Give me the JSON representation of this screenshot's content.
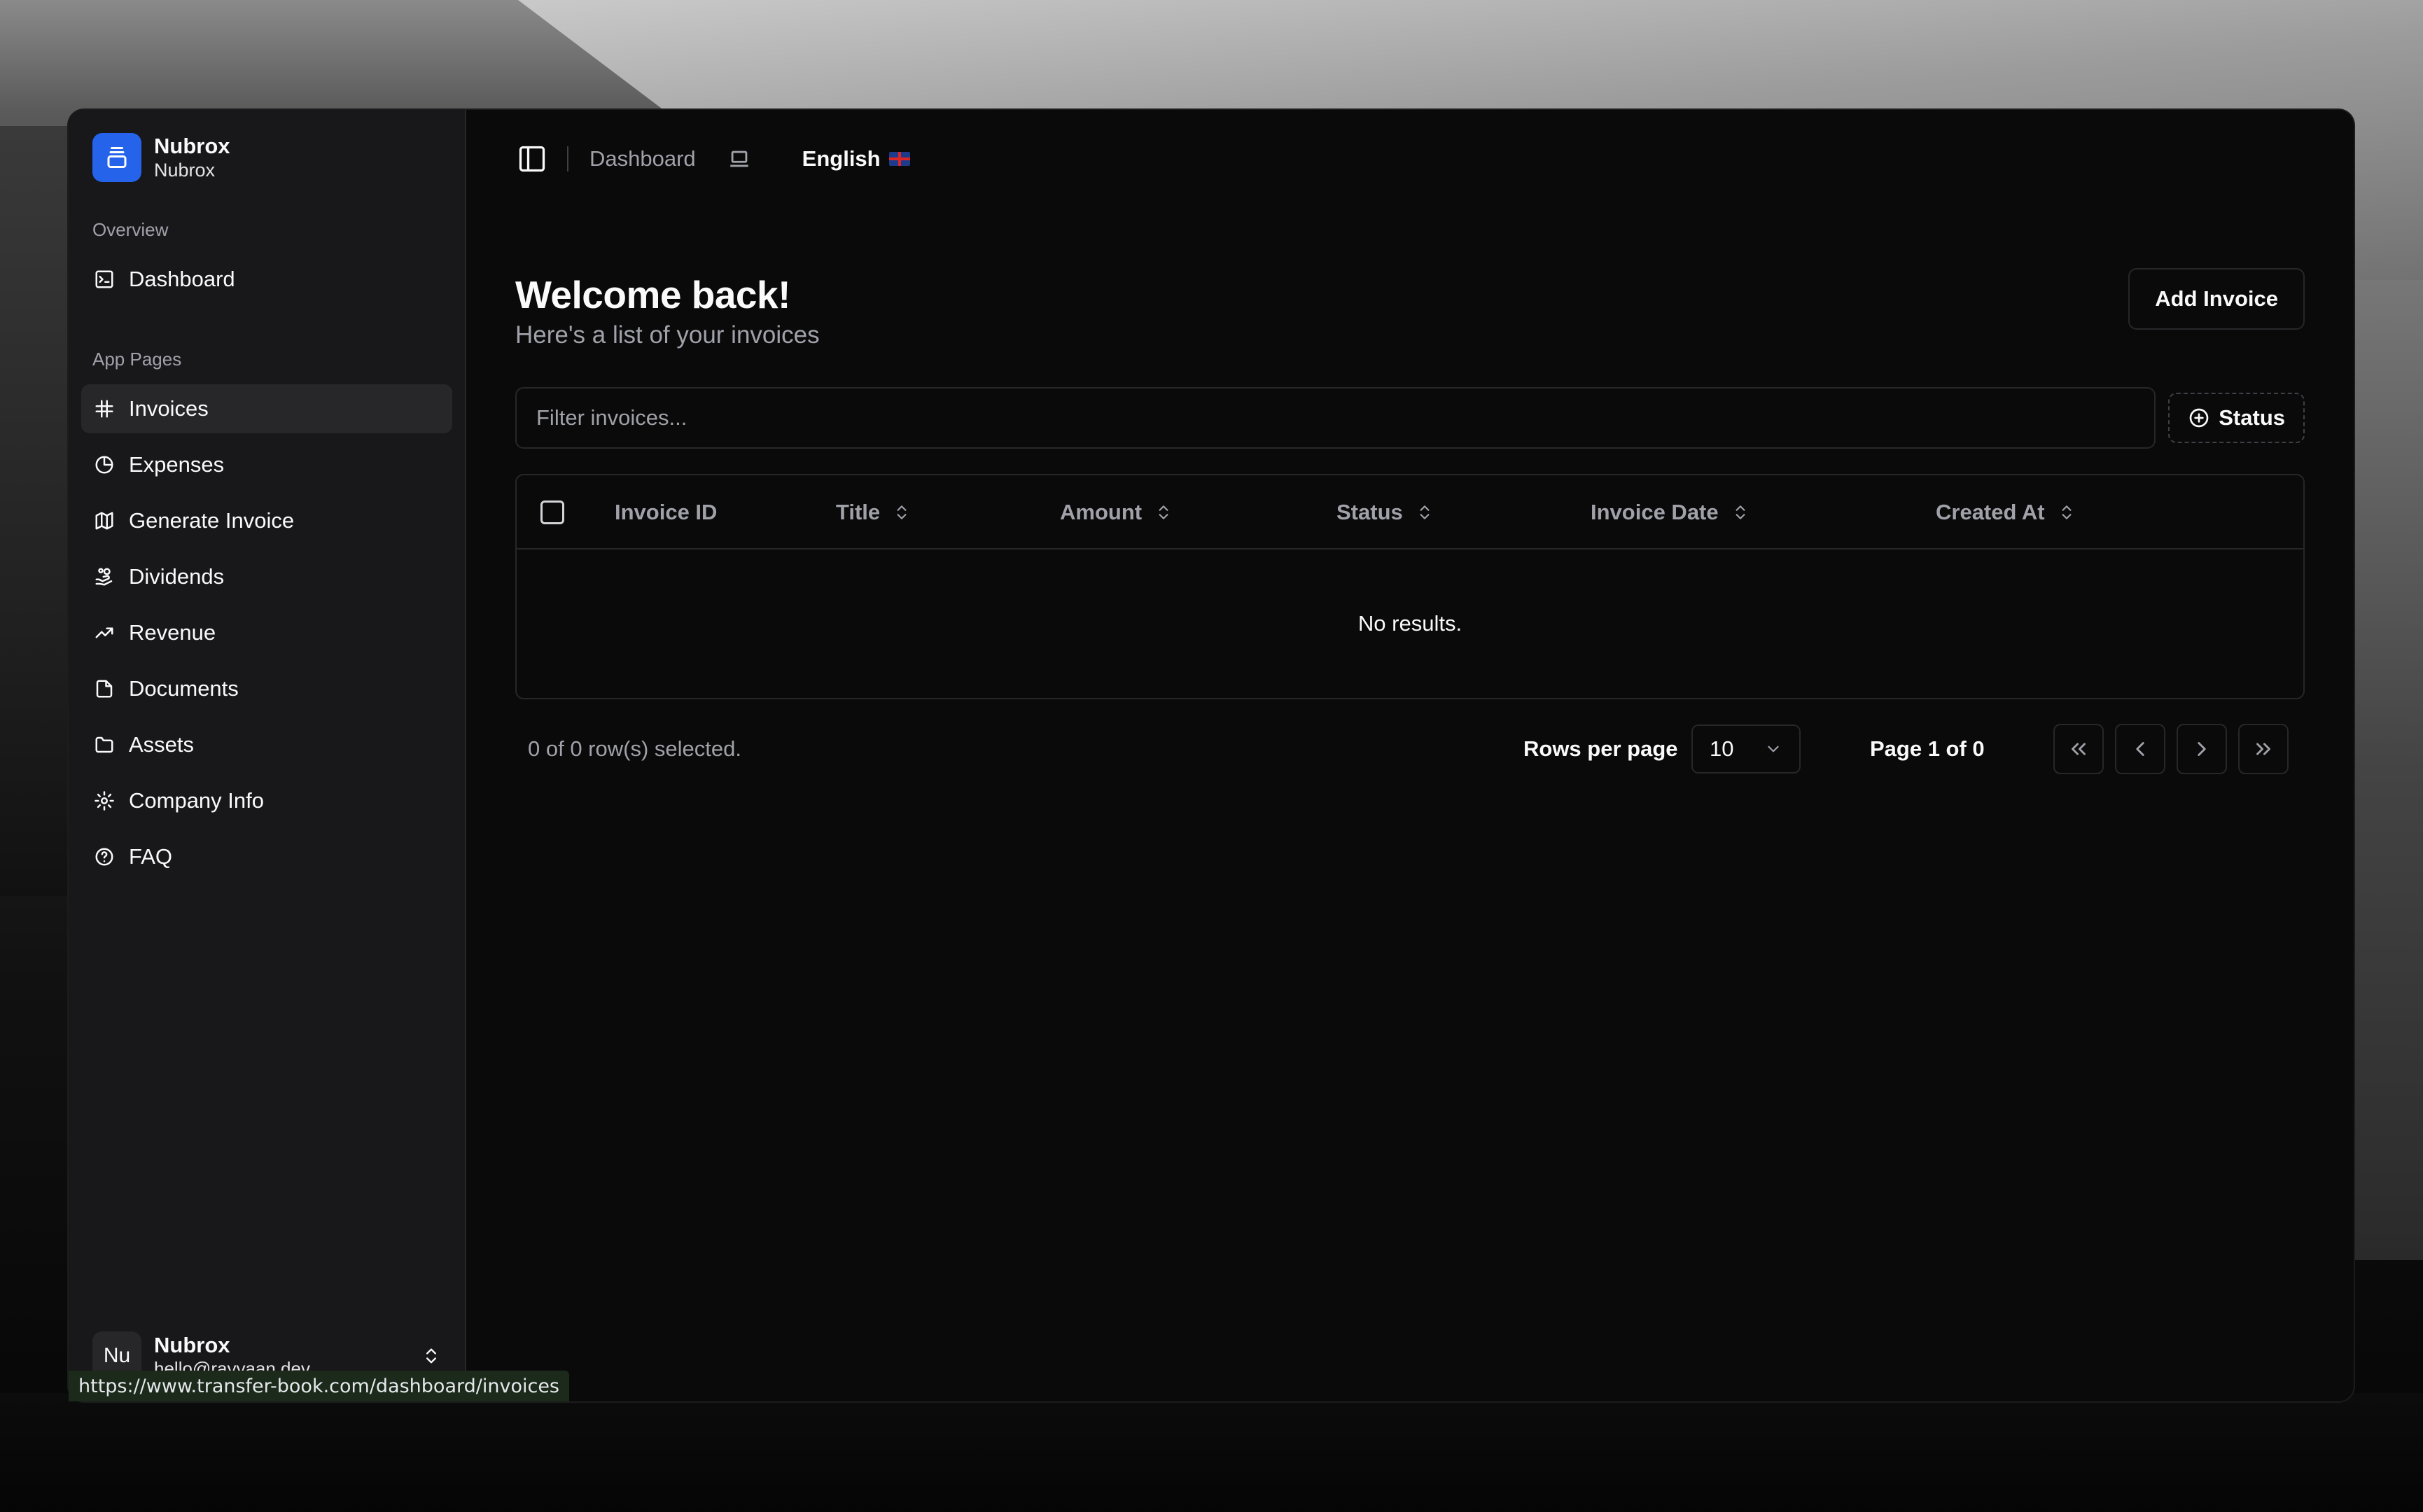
{
  "brand": {
    "name": "Nubrox",
    "subtitle": "Nubrox",
    "accent": "#2563eb"
  },
  "sidebar": {
    "overview_label": "Overview",
    "overview_items": [
      {
        "label": "Dashboard",
        "icon": "dashboard-icon"
      }
    ],
    "app_pages_label": "App Pages",
    "items": [
      {
        "label": "Invoices",
        "icon": "hash-icon",
        "active": true
      },
      {
        "label": "Expenses",
        "icon": "pie-chart-icon"
      },
      {
        "label": "Generate Invoice",
        "icon": "map-icon"
      },
      {
        "label": "Dividends",
        "icon": "hand-coins-icon"
      },
      {
        "label": "Revenue",
        "icon": "trending-up-icon"
      },
      {
        "label": "Documents",
        "icon": "file-icon"
      },
      {
        "label": "Assets",
        "icon": "folder-icon"
      },
      {
        "label": "Company Info",
        "icon": "gear-icon"
      },
      {
        "label": "FAQ",
        "icon": "help-circle-icon"
      }
    ],
    "user": {
      "initials": "Nu",
      "name": "Nubrox",
      "email": "hello@rayyaan.dev"
    }
  },
  "topbar": {
    "breadcrumb": "Dashboard",
    "language": "English"
  },
  "page": {
    "title": "Welcome back!",
    "subtitle": "Here's a list of your invoices",
    "add_button": "Add Invoice"
  },
  "filter": {
    "placeholder": "Filter invoices...",
    "status_button": "Status"
  },
  "table": {
    "columns": [
      "Invoice ID",
      "Title",
      "Amount",
      "Status",
      "Invoice Date",
      "Created At"
    ],
    "empty_text": "No results."
  },
  "pagination": {
    "selected_text": "0 of 0 row(s) selected.",
    "rows_per_page_label": "Rows per page",
    "rows_per_page_value": "10",
    "page_text": "Page 1 of 0"
  },
  "status_bar": {
    "url": "https://www.transfer-book.com/dashboard/invoices"
  }
}
